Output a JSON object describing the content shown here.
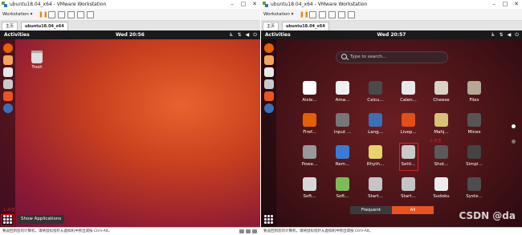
{
  "left": {
    "title": "ubuntu18.04_x64 - VMware Workstation",
    "toolbar": {
      "workstation_label": "Workstation ▾"
    },
    "tabs": {
      "home": "主页",
      "vm": "ubuntu18.04_x64"
    },
    "topbar": {
      "activities": "Activities",
      "clock": "Wed 20:56"
    },
    "desktop": {
      "trash_label": "Trash"
    },
    "show_apps_label": "Show Applications",
    "annotation": "1.点击",
    "status": "要返回到您的计算机，请将鼠标指针从虚拟机中移出或按 Ctrl+Alt。"
  },
  "right": {
    "title": "ubuntu18.04_x64 - VMware Workstation",
    "toolbar": {
      "workstation_label": "Workstation ▾"
    },
    "tabs": {
      "home": "主页",
      "vm": "ubuntu18.04_x64"
    },
    "topbar": {
      "activities": "Activities",
      "clock": "Wed 20:57"
    },
    "search": {
      "placeholder": "Type to search..."
    },
    "apps": [
      {
        "label": "Aisle...",
        "color": "#ffffff"
      },
      {
        "label": "Ama...",
        "color": "#f0f0f0"
      },
      {
        "label": "Calcu...",
        "color": "#4a4a4a"
      },
      {
        "label": "Calen...",
        "color": "#e8e8e8"
      },
      {
        "label": "Cheese",
        "color": "#d9d2c5"
      },
      {
        "label": "Files",
        "color": "#b5a894"
      },
      {
        "label": "",
        "color": "transparent"
      },
      {
        "label": "Firef...",
        "color": "#e66000"
      },
      {
        "label": "Input ...",
        "color": "#777777"
      },
      {
        "label": "Lang...",
        "color": "#3b6fb6"
      },
      {
        "label": "Livep...",
        "color": "#e2501a"
      },
      {
        "label": "Mahj...",
        "color": "#d8c27a"
      },
      {
        "label": "Mines",
        "color": "#555555"
      },
      {
        "label": "",
        "color": "transparent"
      },
      {
        "label": "Powe...",
        "color": "#999999"
      },
      {
        "label": "Rem...",
        "color": "#3a7bd5"
      },
      {
        "label": "Rhyth...",
        "color": "#e6d36a"
      },
      {
        "label": "Setti...",
        "color": "#c9c9c9"
      },
      {
        "label": "Shot...",
        "color": "#5a5a5a"
      },
      {
        "label": "Simpl...",
        "color": "#444444"
      },
      {
        "label": "",
        "color": "transparent"
      },
      {
        "label": "Soft...",
        "color": "#d7d7d7"
      },
      {
        "label": "Soft...",
        "color": "#7dbb57"
      },
      {
        "label": "Start...",
        "color": "#c5c5c5"
      },
      {
        "label": "Start...",
        "color": "#c5c5c5"
      },
      {
        "label": "Sudoku",
        "color": "#ececec"
      },
      {
        "label": "Syste...",
        "color": "#4d4d4d"
      },
      {
        "label": "",
        "color": "transparent"
      }
    ],
    "annotation": "2.点击",
    "tabs_switch": {
      "frequent": "Frequent",
      "all": "All"
    },
    "watermark": "CSDN @da",
    "status": "要返回到您的计算机，请将鼠标指针从虚拟机中移出或按 Ctrl+Alt。"
  },
  "colors": {
    "accent": "#e95420",
    "annotation": "#e02020",
    "topbar": "#1a1a1a"
  }
}
